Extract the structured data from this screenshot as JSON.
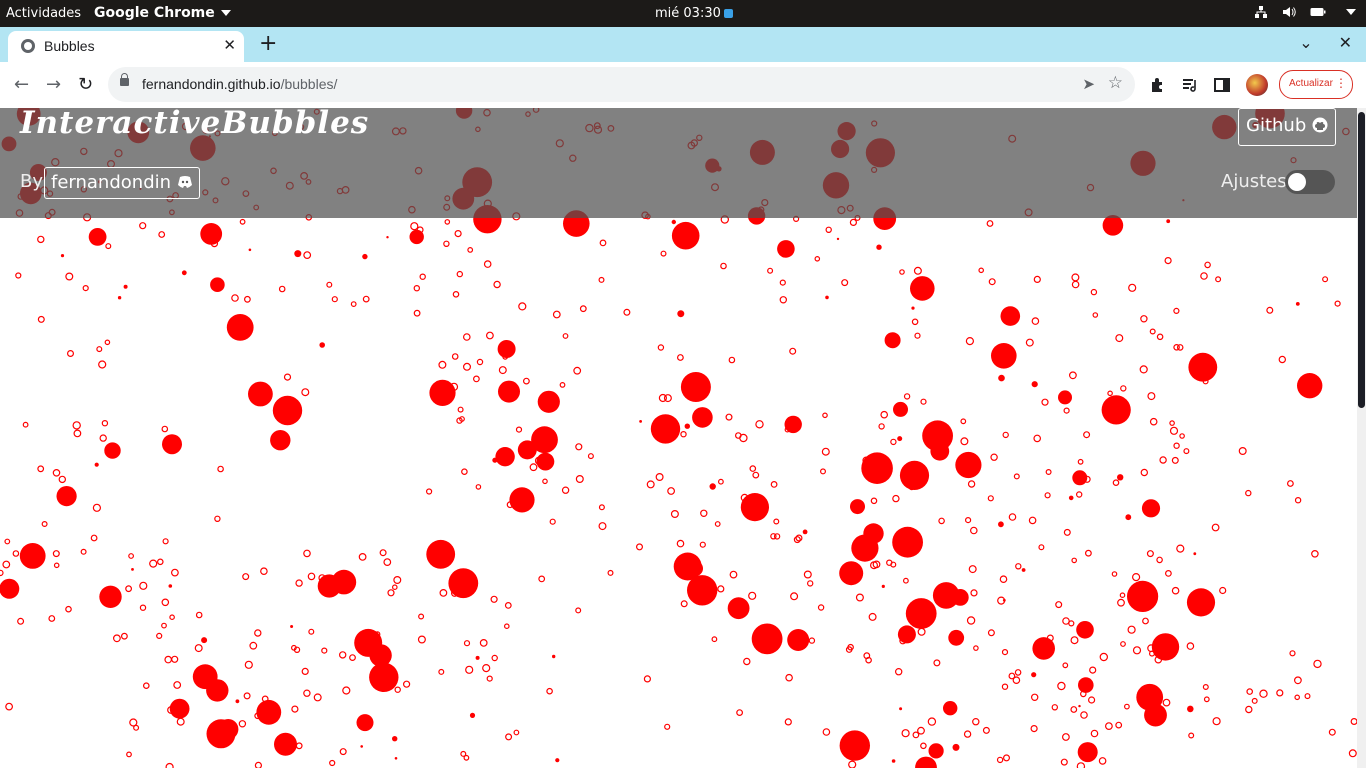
{
  "os_bar": {
    "activities": "Actividades",
    "app": "Google Chrome",
    "clock": "mié 03:30"
  },
  "tab": {
    "title": "Bubbles"
  },
  "omnibox": {
    "host": "fernandondin.github.io",
    "path": "/bubbles/"
  },
  "update_label": "Actualizar",
  "page": {
    "title": "InteractiveBubbles",
    "by": "By",
    "author": "fernandondin",
    "github": "Github",
    "settings": "Ajustes",
    "settings_enabled": false
  },
  "colors": {
    "bubble": "#ff0000",
    "tab_strip": "#b3e5f3",
    "header_overlay": "#505050"
  },
  "icons": [
    "wifi-icon",
    "volume-icon",
    "battery-icon",
    "globe-icon",
    "back-icon",
    "forward-icon",
    "reload-icon",
    "lock-icon",
    "send-icon",
    "star-icon",
    "extensions-icon",
    "reading-list-icon",
    "side-panel-icon",
    "github-icon",
    "discord-icon"
  ]
}
